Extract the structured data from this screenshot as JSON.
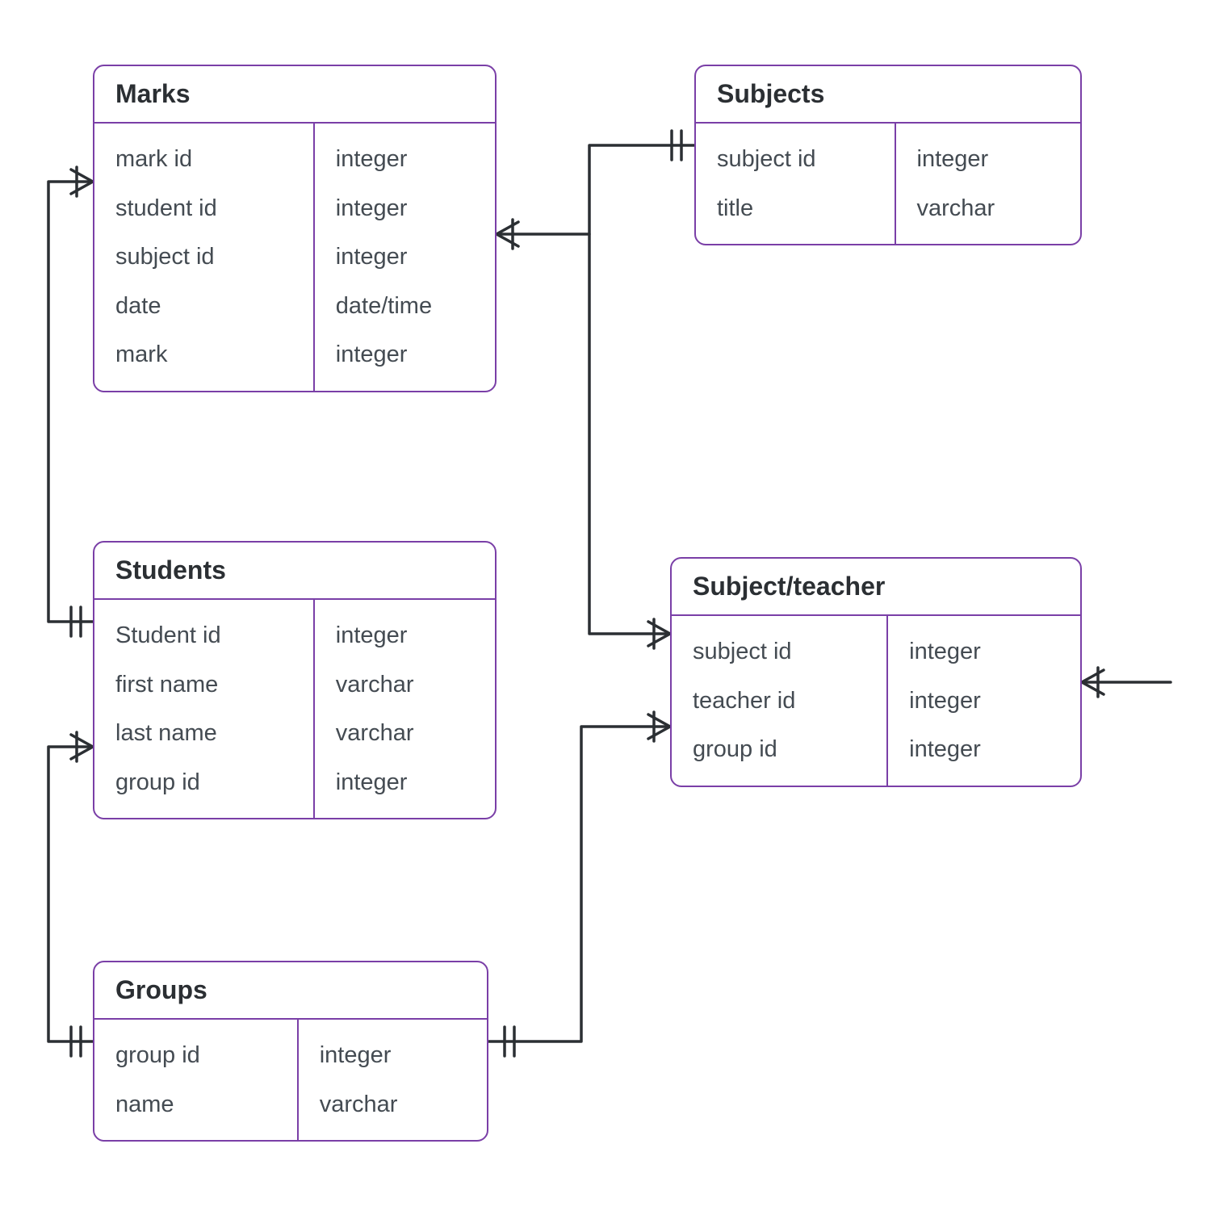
{
  "entities": {
    "marks": {
      "title": "Marks",
      "fields": [
        {
          "name": "mark id",
          "type": "integer"
        },
        {
          "name": "student id",
          "type": "integer"
        },
        {
          "name": "subject id",
          "type": "integer"
        },
        {
          "name": "date",
          "type": "date/time"
        },
        {
          "name": "mark",
          "type": "integer"
        }
      ]
    },
    "subjects": {
      "title": "Subjects",
      "fields": [
        {
          "name": "subject id",
          "type": "integer"
        },
        {
          "name": "title",
          "type": "varchar"
        }
      ]
    },
    "students": {
      "title": "Students",
      "fields": [
        {
          "name": "Student id",
          "type": "integer"
        },
        {
          "name": "first name",
          "type": "varchar"
        },
        {
          "name": "last name",
          "type": "varchar"
        },
        {
          "name": "group id",
          "type": "integer"
        }
      ]
    },
    "subject_teacher": {
      "title": "Subject/teacher",
      "fields": [
        {
          "name": "subject id",
          "type": "integer"
        },
        {
          "name": "teacher id",
          "type": "integer"
        },
        {
          "name": "group id",
          "type": "integer"
        }
      ]
    },
    "groups": {
      "title": "Groups",
      "fields": [
        {
          "name": "group id",
          "type": "integer"
        },
        {
          "name": "name",
          "type": "varchar"
        }
      ]
    }
  },
  "relationships": [
    {
      "from": "marks",
      "to": "students",
      "type": "many-to-one"
    },
    {
      "from": "marks",
      "to": "subjects",
      "type": "many-to-one"
    },
    {
      "from": "students",
      "to": "groups",
      "type": "many-to-one"
    },
    {
      "from": "subject_teacher",
      "to": "subjects",
      "type": "many-to-one"
    },
    {
      "from": "subject_teacher",
      "to": "groups",
      "type": "many-to-one"
    },
    {
      "from": "subject_teacher",
      "to": "teachers",
      "type": "many-to-one"
    }
  ],
  "colors": {
    "border": "#7a3fa7",
    "line": "#2b2f33"
  }
}
